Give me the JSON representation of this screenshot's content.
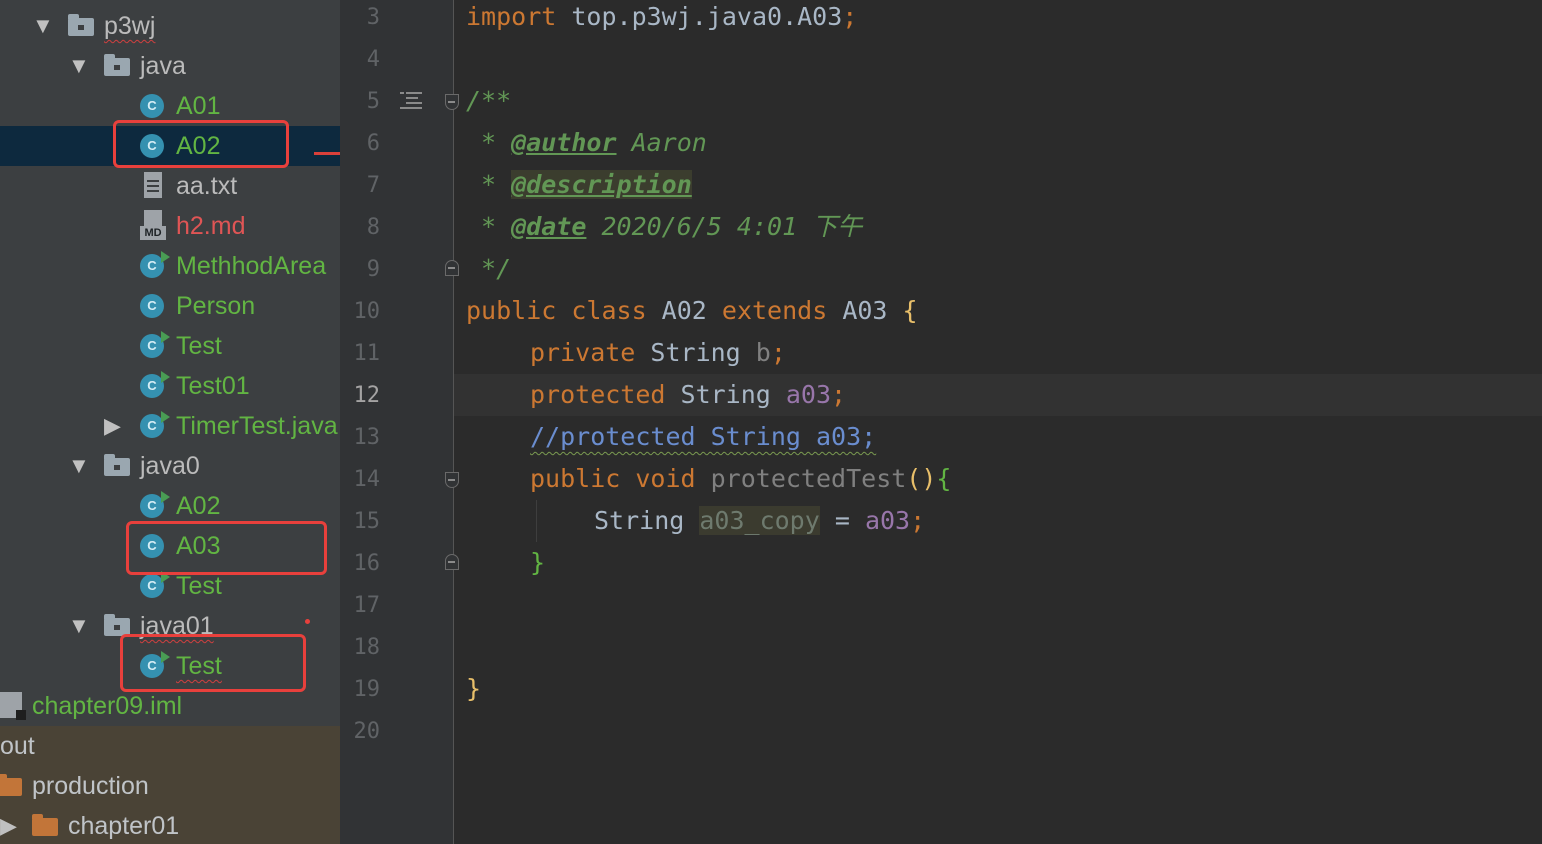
{
  "tree": {
    "rows": [
      {
        "label": "p3wj",
        "kind": "package",
        "expanded": true
      },
      {
        "label": "java",
        "kind": "package",
        "expanded": true
      },
      {
        "label": "A01",
        "kind": "class"
      },
      {
        "label": "A02",
        "kind": "class",
        "selected": true
      },
      {
        "label": "aa.txt",
        "kind": "text-file"
      },
      {
        "label": "h2.md",
        "kind": "markdown-file"
      },
      {
        "label": "MethhodArea",
        "kind": "runnable-class"
      },
      {
        "label": "Person",
        "kind": "class"
      },
      {
        "label": "Test",
        "kind": "runnable-class"
      },
      {
        "label": "Test01",
        "kind": "runnable-class"
      },
      {
        "label": "TimerTest.java",
        "kind": "runnable-class",
        "expanded": false
      },
      {
        "label": "java0",
        "kind": "package",
        "expanded": true
      },
      {
        "label": "A02",
        "kind": "runnable-class"
      },
      {
        "label": "A03",
        "kind": "class"
      },
      {
        "label": "Test",
        "kind": "runnable-class"
      },
      {
        "label": "java01",
        "kind": "package",
        "expanded": true
      },
      {
        "label": "Test",
        "kind": "runnable-class"
      },
      {
        "label": "chapter09.iml",
        "kind": "iml-file"
      },
      {
        "label": "out",
        "kind": "excluded-folder"
      },
      {
        "label": "production",
        "kind": "folder"
      },
      {
        "label": "chapter01",
        "kind": "folder",
        "expanded": false
      }
    ],
    "class_icon_letter": "C",
    "md_icon_letter": "MD"
  },
  "editor": {
    "line_numbers": [
      "3",
      "4",
      "5",
      "6",
      "7",
      "8",
      "9",
      "10",
      "11",
      "12",
      "13",
      "14",
      "15",
      "16",
      "17",
      "18",
      "19",
      "20"
    ],
    "current_line": "12",
    "code": {
      "l3_kw": "import",
      "l3_rest": " top.p3wj.java0.A03",
      "l3_semi": ";",
      "l5": "/**",
      "l6_star": " * ",
      "l6_tag": "@author",
      "l6_val": " Aaron",
      "l7_star": " * ",
      "l7_tag": "@description",
      "l8_star": " * ",
      "l8_tag": "@date",
      "l8_val": " 2020/6/5 4:01 下午",
      "l9": " */",
      "l10_kw1": "public class ",
      "l10_name": "A02 ",
      "l10_kw2": "extends ",
      "l10_super": "A03 ",
      "l10_brace": "{",
      "l11_kw": "private ",
      "l11_type": "String ",
      "l11_field": "b",
      "l11_semi": ";",
      "l12_kw": "protected ",
      "l12_type": "String ",
      "l12_field": "a03",
      "l12_semi": ";",
      "l13_comment": "//protected String a03;",
      "l14_kw": "public void ",
      "l14_method": "protectedTest",
      "l14_parens": "()",
      "l14_brace": "{",
      "l15_type": "String ",
      "l15_var": "a03_copy",
      "l15_eq": " = ",
      "l15_field": "a03",
      "l15_semi": ";",
      "l16_brace": "}",
      "l19_brace": "}"
    }
  },
  "colors": {
    "highlight_box": "#e8403c",
    "keyword": "#cc7832",
    "field": "#9876aa",
    "doc_comment": "#629755",
    "tree_class_label": "#62b543",
    "tree_md_label": "#e05555"
  }
}
